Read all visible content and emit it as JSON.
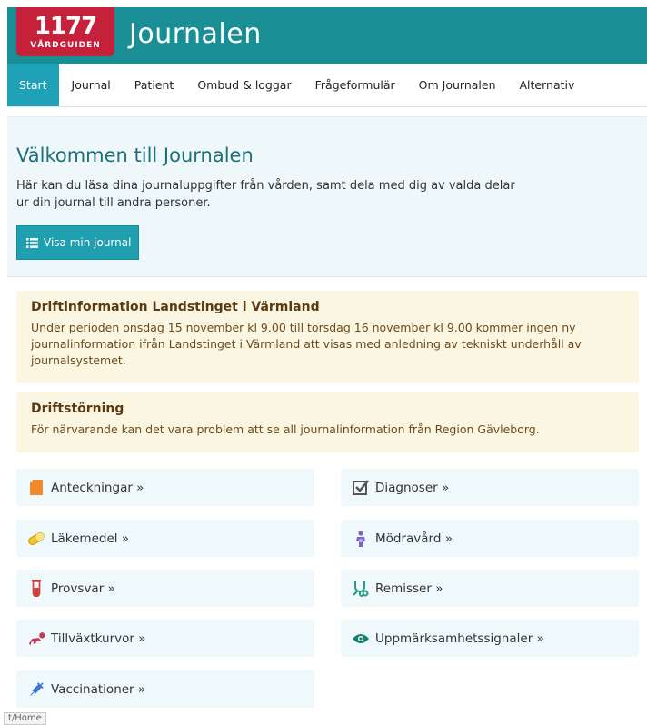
{
  "header": {
    "logo_number": "1177",
    "logo_sub": "VÅRDGUIDEN",
    "title": "Journalen"
  },
  "nav": {
    "items": [
      {
        "label": "Start",
        "active": true
      },
      {
        "label": "Journal"
      },
      {
        "label": "Patient"
      },
      {
        "label": "Ombud & loggar"
      },
      {
        "label": "Frågeformulär"
      },
      {
        "label": "Om Journalen"
      },
      {
        "label": "Alternativ"
      }
    ]
  },
  "welcome": {
    "title": "Välkommen till Journalen",
    "text": "Här kan du läsa dina journaluppgifter från vården, samt dela med dig av valda delar ur din journal till andra personer.",
    "button_label": "Visa min journal"
  },
  "alerts": [
    {
      "title": "Driftinformation Landstinget i Värmland",
      "text": "Under perioden onsdag 15 november kl 9.00 till torsdag 16 november kl 9.00 kommer ingen ny journalinformation ifrån Landstinget i Värmland att visas med anledning av tekniskt underhåll av journalsystemet."
    },
    {
      "title": "Driftstörning",
      "text": "För närvarande kan det vara problem att se all journalinformation från Region Gävleborg."
    }
  ],
  "tiles": [
    {
      "label": "Anteckningar »",
      "icon": "notes-icon"
    },
    {
      "label": "Diagnoser »",
      "icon": "checkbox-icon"
    },
    {
      "label": "Läkemedel »",
      "icon": "pill-icon"
    },
    {
      "label": "Mödravård »",
      "icon": "mother-icon"
    },
    {
      "label": "Provsvar »",
      "icon": "test-tube-icon"
    },
    {
      "label": "Remisser »",
      "icon": "stethoscope-icon"
    },
    {
      "label": "Tillväxtkurvor »",
      "icon": "crawling-baby-icon"
    },
    {
      "label": "Uppmärksamhetssignaler »",
      "icon": "eye-icon"
    },
    {
      "label": "Vaccinationer »",
      "icon": "syringe-icon"
    }
  ],
  "status_bar": {
    "url": "t/Home"
  },
  "colors": {
    "header": "#198f95",
    "logo": "#c6213b",
    "nav_active": "#1fa2b8",
    "welcome_bg": "#eef8fb",
    "alert_bg": "#fbf6e2",
    "tile_bg": "#eff8fa"
  }
}
